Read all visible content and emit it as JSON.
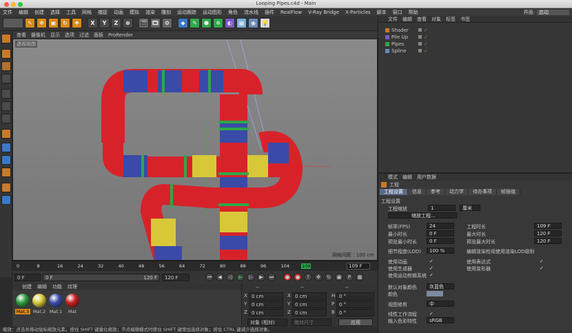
{
  "window": {
    "title": "Looping Pipes.c4d - Main"
  },
  "menu": [
    "文件",
    "编辑",
    "创建",
    "选择",
    "工具",
    "网格",
    "捕捉",
    "动画",
    "模拟",
    "渲染",
    "雕刻",
    "运动跟踪",
    "运动图形",
    "角色",
    "流水线",
    "插件",
    "RealFlow",
    "V-Ray Bridge",
    "X-Particles",
    "脚本",
    "窗口",
    "帮助"
  ],
  "layout": {
    "label": "界面:",
    "value": "启动"
  },
  "toolbar": {
    "xyz": [
      "X",
      "Y",
      "Z"
    ]
  },
  "viewport": {
    "menu": [
      "查看",
      "摄像机",
      "显示",
      "选项",
      "过滤",
      "面板",
      "ProRender"
    ],
    "label": "透视视图",
    "grid": "网格间距 : 100 cm"
  },
  "timeline": {
    "ticks": [
      "0",
      "8",
      "16",
      "24",
      "32",
      "40",
      "48",
      "56",
      "64",
      "72",
      "80",
      "88",
      "96",
      "104",
      "109"
    ],
    "current": "109",
    "current_field": "109 F"
  },
  "transport": {
    "start": "0 F",
    "min": "0 F",
    "max": "120 F",
    "end": "120 F"
  },
  "materials": {
    "menu": [
      "创建",
      "编辑",
      "功能",
      "纹理"
    ],
    "items": [
      {
        "name": "Mat.3",
        "color": "#2a9a3a"
      },
      {
        "name": "Mat.2",
        "color": "#d8c838"
      },
      {
        "name": "Mat.1",
        "color": "#3a4aa8"
      },
      {
        "name": "Mat",
        "color": "#c81e1e"
      }
    ]
  },
  "coords": {
    "head": [
      "--",
      "--",
      "--"
    ],
    "rows": [
      {
        "a": "X",
        "av": "0 cm",
        "b": "X",
        "bv": "0 cm",
        "c": "H",
        "cv": "0 °"
      },
      {
        "a": "Y",
        "av": "0 cm",
        "b": "Y",
        "bv": "0 cm",
        "c": "P",
        "cv": "0 °"
      },
      {
        "a": "Z",
        "av": "0 cm",
        "b": "Z",
        "bv": "0 cm",
        "c": "B",
        "cv": "0 °"
      }
    ],
    "mode": "对象 (相对)",
    "size": "绝对尺寸",
    "apply": "应用"
  },
  "objects": {
    "menu": [
      "文件",
      "编辑",
      "查看",
      "对象",
      "标签",
      "书签"
    ],
    "items": [
      "Shader",
      "Pile Up",
      "Pipes",
      "Spline"
    ]
  },
  "attributes": {
    "menu": [
      "模式",
      "编辑",
      "用户数据"
    ],
    "header": "工程",
    "tabs": [
      "工程设置",
      "信息",
      "参考",
      "动力学",
      "待办事项",
      "帧插值"
    ],
    "section": "工程设置",
    "scale_label": "工程缩放",
    "scale_value": "1",
    "scale_unit": "厘米",
    "scale_btn": "缩放工程...",
    "fields": [
      {
        "l": "帧率(FPS)",
        "v": "24",
        "r": "工程时长",
        "rv": "109 F"
      },
      {
        "l": "最小时长",
        "v": "0 F",
        "r": "最大时长",
        "rv": "120 F"
      },
      {
        "l": "预览最小时长",
        "v": "0 F",
        "r": "预览最大时长",
        "rv": "120 F"
      }
    ],
    "lod_label": "细节程度(LOD)",
    "lod_value": "100 %",
    "lod_right": "编辑渲染检视使用渲染LOD级别",
    "checks_left": [
      "使用动画",
      "使用生成器",
      "使用运动剪辑系统"
    ],
    "checks_right": [
      "使用表达式",
      "使用变形器"
    ],
    "default_color_label": "默认对象颜色",
    "default_color_value": "灰蓝色",
    "color_label": "颜色",
    "view_label": "视图修剪",
    "view_value": "中",
    "linear_label": "线性工作流程",
    "input_label": "输入色彩特性",
    "input_value": "sRGB"
  },
  "status": "缩放：点击并拖动鼠标缩放元素。按住 SHIFT 键量化缩放；节点编辑模式时按住 SHIFT 键增加选择对象；按住 CTRL 键减少选择对象。"
}
